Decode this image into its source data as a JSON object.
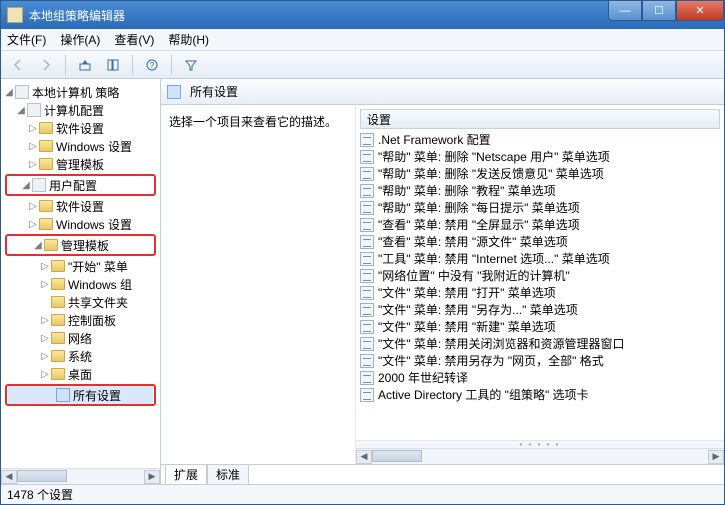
{
  "window": {
    "title": "本地组策略编辑器"
  },
  "menubar": [
    "文件(F)",
    "操作(A)",
    "查看(V)",
    "帮助(H)"
  ],
  "tree": {
    "root": "本地计算机 策略",
    "computer_config": "计算机配置",
    "cc_children": [
      "软件设置",
      "Windows 设置",
      "管理模板"
    ],
    "user_config": "用户配置",
    "uc_software": "软件设置",
    "uc_windows": "Windows 设置",
    "uc_admin": "管理模板",
    "admin_children": [
      "\"开始\" 菜单",
      "Windows 组",
      "共享文件夹",
      "控制面板",
      "网络",
      "系统",
      "桌面"
    ],
    "all_settings": "所有设置"
  },
  "right": {
    "header": "所有设置",
    "description_hint": "选择一个项目来查看它的描述。",
    "column": "设置",
    "items": [
      ".Net Framework 配置",
      "\"帮助\" 菜单: 删除 \"Netscape 用户\" 菜单选项",
      "\"帮助\" 菜单: 删除 \"发送反馈意见\" 菜单选项",
      "\"帮助\" 菜单: 删除 \"教程\" 菜单选项",
      "\"帮助\" 菜单: 删除 \"每日提示\" 菜单选项",
      "\"查看\" 菜单: 禁用 \"全屏显示\" 菜单选项",
      "\"查看\" 菜单: 禁用 \"源文件\" 菜单选项",
      "\"工具\" 菜单: 禁用 \"Internet 选项...\" 菜单选项",
      "\"网络位置\" 中没有 \"我附近的计算机\"",
      "\"文件\" 菜单: 禁用 \"打开\" 菜单选项",
      "\"文件\" 菜单: 禁用 \"另存为...\" 菜单选项",
      "\"文件\" 菜单: 禁用 \"新建\" 菜单选项",
      "\"文件\" 菜单: 禁用关闭浏览器和资源管理器窗口",
      "\"文件\" 菜单: 禁用另存为 \"网页，全部\" 格式",
      "2000 年世纪转译",
      "Active Directory 工具的 \"组策略\" 选项卡"
    ]
  },
  "tabs": {
    "extended": "扩展",
    "standard": "标准"
  },
  "status": "1478 个设置"
}
